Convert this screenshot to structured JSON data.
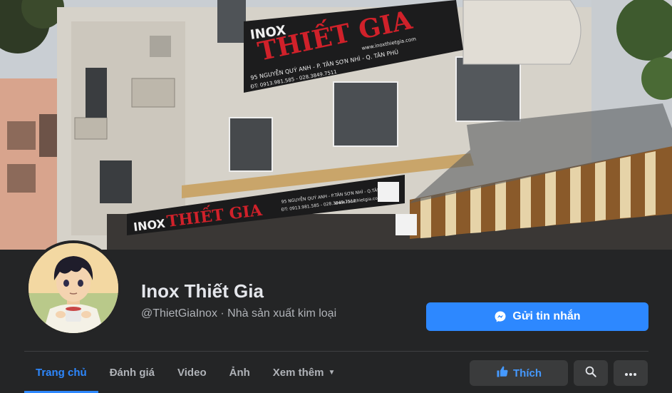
{
  "cover": {
    "sign_top_brand": "INOX",
    "sign_top_name": "THIẾT GIA",
    "sign_top_address": "95 NGUYỄN QUÝ ANH - P. TÂN SƠN NHÌ - Q. TÂN PHÚ",
    "sign_top_phone": "ĐT: 0913.981.585 - 028.3849.7511",
    "sign_top_web": "www.inoxthietgia.com",
    "sign_bottom_brand": "INOX",
    "sign_bottom_name": "THIẾT GIA",
    "sign_bottom_address": "95 NGUYỄN QUÝ ANH - P.TÂN SƠN NHÌ - Q.TÂN PHÚ",
    "sign_bottom_phone": "ĐT: 0913.981.585 - 028.3849.7511",
    "sign_bottom_web": "www.inoxthietgia.com"
  },
  "profile": {
    "name": "Inox Thiết Gia",
    "subtitle": "@ThietGiaInox · Nhà sản xuất kim loại"
  },
  "message_button": {
    "label": "Gửi tin nhắn",
    "icon": "messenger-icon"
  },
  "tabs": [
    {
      "label": "Trang chủ",
      "active": true
    },
    {
      "label": "Đánh giá",
      "active": false
    },
    {
      "label": "Video",
      "active": false
    },
    {
      "label": "Ảnh",
      "active": false
    },
    {
      "label": "Xem thêm",
      "active": false
    }
  ],
  "actions": {
    "like_label": "Thích",
    "like_icon": "thumbs-up-icon",
    "search_icon": "search-icon",
    "more_icon": "more-horizontal-icon"
  },
  "colors": {
    "background": "#242526",
    "accent": "#2d88ff",
    "button_gray": "#3a3b3c",
    "text_primary": "#e4e6eb",
    "text_secondary": "#b0b3b8"
  }
}
